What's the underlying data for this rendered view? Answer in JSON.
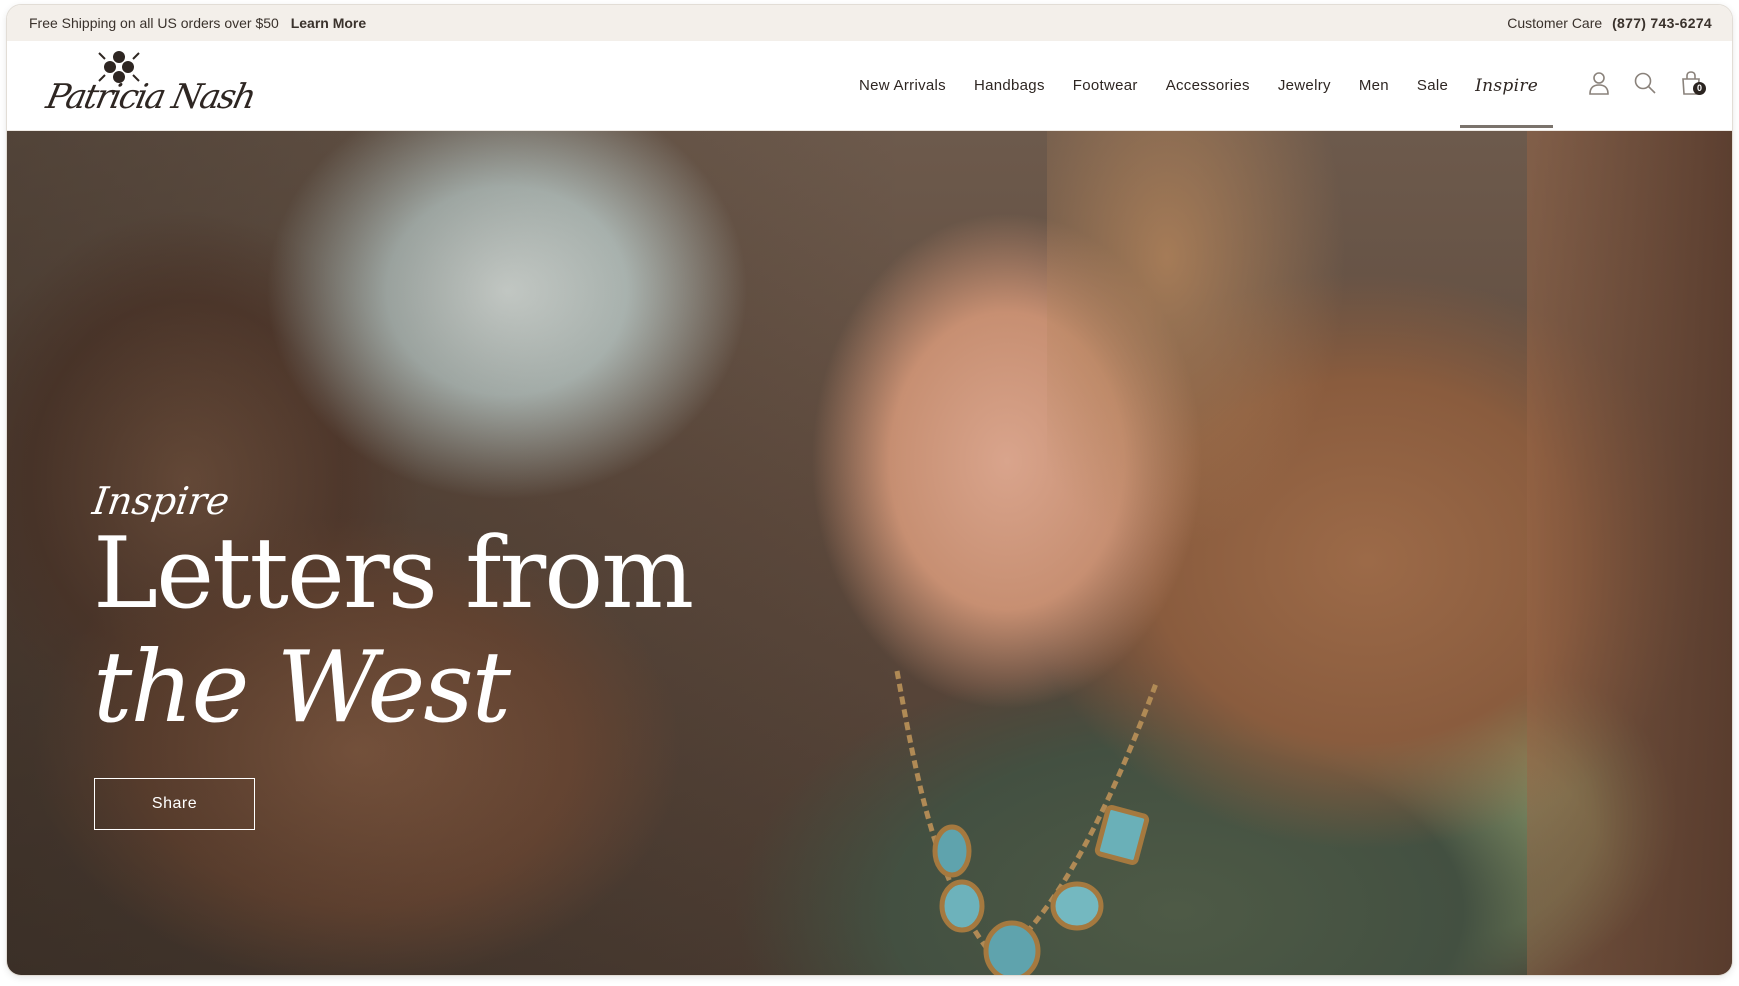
{
  "promo": {
    "shipping_text": "Free Shipping on all US orders over $50",
    "learn_more": "Learn More",
    "customer_care_label": "Customer Care",
    "phone": "(877) 743-6274"
  },
  "header": {
    "logo_text": "Patricia Nash",
    "nav": [
      {
        "label": "New Arrivals"
      },
      {
        "label": "Handbags"
      },
      {
        "label": "Footwear"
      },
      {
        "label": "Accessories"
      },
      {
        "label": "Jewelry"
      },
      {
        "label": "Men"
      },
      {
        "label": "Sale"
      },
      {
        "label": "Inspire",
        "active": true
      }
    ],
    "icons": [
      "account-icon",
      "search-icon",
      "shopping-bag-icon"
    ],
    "cart_count": "0"
  },
  "hero": {
    "kicker": "Inspire",
    "headline_line1": "Letters from",
    "headline_line2": "the West",
    "button_label": "Share"
  },
  "colors": {
    "promo_bg": "#f3efea",
    "text_dark": "#2b2420",
    "icon_gray": "#8a827b",
    "active_underline": "#7a736c"
  }
}
